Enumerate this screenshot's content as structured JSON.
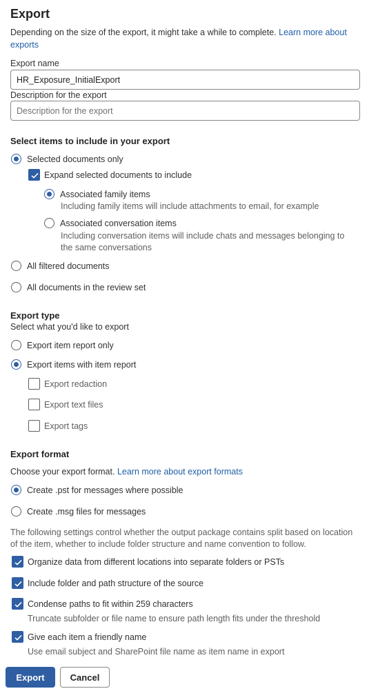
{
  "panel": {
    "title": "Export",
    "intro_text": "Depending on the size of the export, it might take a while to complete. ",
    "intro_link": "Learn more about exports"
  },
  "export_name": {
    "label": "Export name",
    "value": "HR_Exposure_InitialExport"
  },
  "description": {
    "label": "Description for the export",
    "value": "",
    "placeholder": "Description for the export"
  },
  "select_items": {
    "heading": "Select items to include in your export",
    "selected_docs": "Selected documents only",
    "expand_selected": "Expand selected documents to include",
    "family_items": "Associated family items",
    "family_desc": "Including family items will include attachments to email, for example",
    "conversation_items": "Associated conversation items",
    "conversation_desc_1": "Including conversation items will include chats and messages belonging to",
    "conversation_desc_2": "the same conversations",
    "all_filtered": "All filtered documents",
    "all_review_set": "All documents in the review set"
  },
  "export_type": {
    "heading": "Export type",
    "subtitle": "Select what you'd like to export",
    "report_only": "Export item report only",
    "items_with_report": "Export items with item report",
    "redaction": "Export redaction",
    "text_files": "Export text files",
    "tags": "Export tags"
  },
  "export_format": {
    "heading": "Export format",
    "choose_text": "Choose your export format. ",
    "choose_link": "Learn more about export formats",
    "pst": "Create .pst for messages where possible",
    "msg": "Create .msg files for messages",
    "settings_note_1": "The following settings control whether the output package contains split based on location",
    "settings_note_2": "of the item, whether to include folder structure and name convention to follow.",
    "organize": "Organize data from different locations into separate folders or PSTs",
    "include_folder": "Include folder and path structure of the source",
    "condense": "Condense paths to fit within 259 characters",
    "condense_desc": "Truncate subfolder or file name to ensure path length fits under the threshold",
    "friendly": "Give each item a friendly name",
    "friendly_desc": "Use email subject and SharePoint file name as item name in export"
  },
  "buttons": {
    "export": "Export",
    "cancel": "Cancel"
  },
  "colors": {
    "accent": "#2f5ea3",
    "link": "#1f5fa8"
  }
}
